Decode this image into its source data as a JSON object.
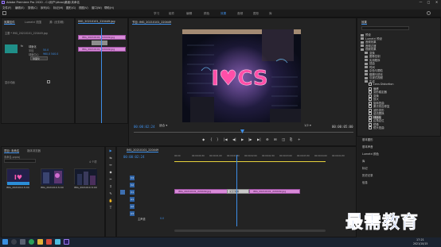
{
  "app": {
    "title": "Adobe Premiere Pro 2020 - C:\\用户\\Ahao\\桌面\\未命名",
    "window_controls": [
      "—",
      "□",
      "✕"
    ]
  },
  "menu": [
    "文件(F)",
    "编辑(E)",
    "剪辑(C)",
    "序列(S)",
    "标记(M)",
    "图形(G)",
    "视图(V)",
    "窗口(W)",
    "帮助(H)"
  ],
  "workspaces": {
    "items": [
      "学习",
      "组件",
      "编辑",
      "颜色",
      "效果",
      "音频",
      "图形",
      "库"
    ],
    "selected": "效果"
  },
  "source_panel": {
    "tabs": [
      "效果控件",
      "Lumetri 范围",
      "源: (无剪辑)"
    ],
    "clip_header": "主要 * IMG_20210101_220449.jpg",
    "effect_name": "球面化",
    "fields": [
      {
        "label": "半径",
        "value": "50.0"
      },
      {
        "label": "球面中心",
        "value": "960.0   540.0"
      }
    ],
    "sub": "球面化",
    "fx_label": "fx",
    "bottom_label": "显示动画"
  },
  "mini_timeline": {
    "header": "IMG_20210101_220449.jpg",
    "clips": [
      "IMG_20210101_220449.jpg",
      "IMG_20210101_220449.jpg"
    ]
  },
  "program": {
    "tab": "节目: IMG_20210101_220449",
    "neon_text": "I♥CS",
    "current_timecode": "00:00:02:24",
    "fit": "适合",
    "quality": "1/2",
    "duration": "00:00:05:00",
    "controls": [
      "◆",
      "{",
      "}",
      "|◀",
      "◀|",
      "▶",
      "|▶",
      "▶|",
      "⊕",
      "⊞",
      "◫",
      "⎘",
      "+"
    ]
  },
  "project": {
    "tabs": [
      "项目: 未命名",
      "媒体浏览器"
    ],
    "file": "未命名.prproj",
    "count": "4 个项",
    "items": [
      {
        "name": "IMG_2021010...",
        "duration": "5:00"
      },
      {
        "name": "IMG_2021010...",
        "duration": "5:00"
      },
      {
        "name": "IMG_2021010...",
        "duration": "5:00"
      }
    ]
  },
  "tools": [
    "▶",
    "⇆",
    "↔",
    "◆",
    "✂",
    "↕",
    "✎",
    "✋",
    "T"
  ],
  "timeline": {
    "tab": "IMG_20210101_220449",
    "timecode": "00:00:02:24",
    "ruler": [
      "00:00",
      "00:00:00:30",
      "00:00:01:00",
      "00:00:01:30",
      "00:00:02:00",
      "00:00:02:30",
      "00:00:03:00",
      "00:00:03:30",
      "00:00:04:00",
      "00:00:04:30"
    ],
    "video_tracks": [
      "V3",
      "V2",
      "V1"
    ],
    "audio_tracks": [
      "A1",
      "A2",
      "A3"
    ],
    "master": "主声道",
    "master_value": "0.0",
    "clip_left": "IMG_20210101_220449.jpg",
    "clip_right": "IMG_20210101_220449.jpg",
    "transition": "交叉溶解"
  },
  "effects": {
    "tab": "效果",
    "search_placeholder": "",
    "items": [
      {
        "label": "预设",
        "indent": 0
      },
      {
        "label": "Lumetri 预设",
        "indent": 0
      },
      {
        "label": "音频效果",
        "indent": 0
      },
      {
        "label": "音频过渡",
        "indent": 0
      },
      {
        "label": "视频效果",
        "indent": 0
      },
      {
        "label": "变换",
        "indent": 1
      },
      {
        "label": "图像控制",
        "indent": 1
      },
      {
        "label": "实用程序",
        "indent": 1
      },
      {
        "label": "扭曲",
        "indent": 1
      },
      {
        "label": "时间",
        "indent": 1
      },
      {
        "label": "杂色与颗粒",
        "indent": 1
      },
      {
        "label": "模糊与锐化",
        "indent": 1
      },
      {
        "label": "沉浸式视频",
        "indent": 1
      },
      {
        "label": "生成",
        "indent": 1
      },
      {
        "label": "Lens Distortion",
        "indent": 2
      },
      {
        "label": "偏移",
        "indent": 2
      },
      {
        "label": "变形稳定器",
        "indent": 2
      },
      {
        "label": "变换",
        "indent": 2
      },
      {
        "label": "放大",
        "indent": 2
      },
      {
        "label": "旋转扭曲",
        "indent": 2
      },
      {
        "label": "果冻效应修复",
        "indent": 2
      },
      {
        "label": "波形变形",
        "indent": 2
      },
      {
        "label": "湍流置换",
        "indent": 2
      },
      {
        "label": "球面化",
        "indent": 2
      },
      {
        "label": "边角定位",
        "indent": 2
      },
      {
        "label": "镜像",
        "indent": 2
      },
      {
        "label": "镜头扭曲",
        "indent": 2
      }
    ]
  },
  "right_panels": [
    "基本图形",
    "基本声音",
    "Lumetri 颜色",
    "库",
    "标记",
    "历史记录",
    "信息"
  ],
  "taskbar": {
    "time": "17:21",
    "date": "2021/10/15"
  },
  "watermark": "最需教育"
}
